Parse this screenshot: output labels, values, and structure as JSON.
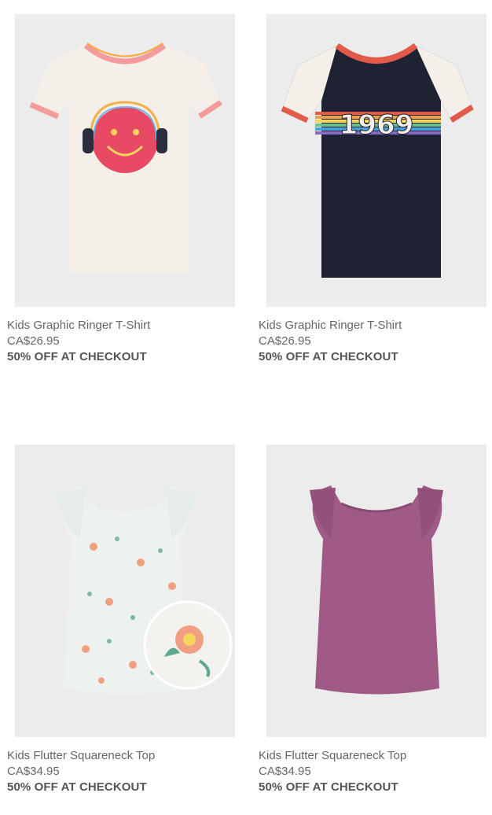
{
  "products": [
    {
      "name": "Kids Graphic Ringer T-Shirt",
      "price": "CA$26.95",
      "promo": "50% OFF AT CHECKOUT",
      "image_icon": "smiley-headphones-tshirt-image",
      "colors": {
        "body": "#f4efe8",
        "trim": "#f49b9b",
        "graphic": "#e84a63"
      }
    },
    {
      "name": "Kids Graphic Ringer T-Shirt",
      "price": "CA$26.95",
      "promo": "50% OFF AT CHECKOUT",
      "image_icon": "1969-rainbow-tshirt-image",
      "colors": {
        "body": "#1e2233",
        "trim": "#e25a4a",
        "sleeve": "#f4efe8"
      }
    },
    {
      "name": "Kids Flutter Squareneck Top",
      "price": "CA$34.95",
      "promo": "50% OFF AT CHECKOUT",
      "image_icon": "floral-flutter-top-image",
      "colors": {
        "body": "#eef2ee",
        "flower": "#f0a080",
        "leaf": "#7fb8a4"
      }
    },
    {
      "name": "Kids Flutter Squareneck Top",
      "price": "CA$34.95",
      "promo": "50% OFF AT CHECKOUT",
      "image_icon": "purple-flutter-top-image",
      "colors": {
        "body": "#a05a86"
      }
    }
  ]
}
